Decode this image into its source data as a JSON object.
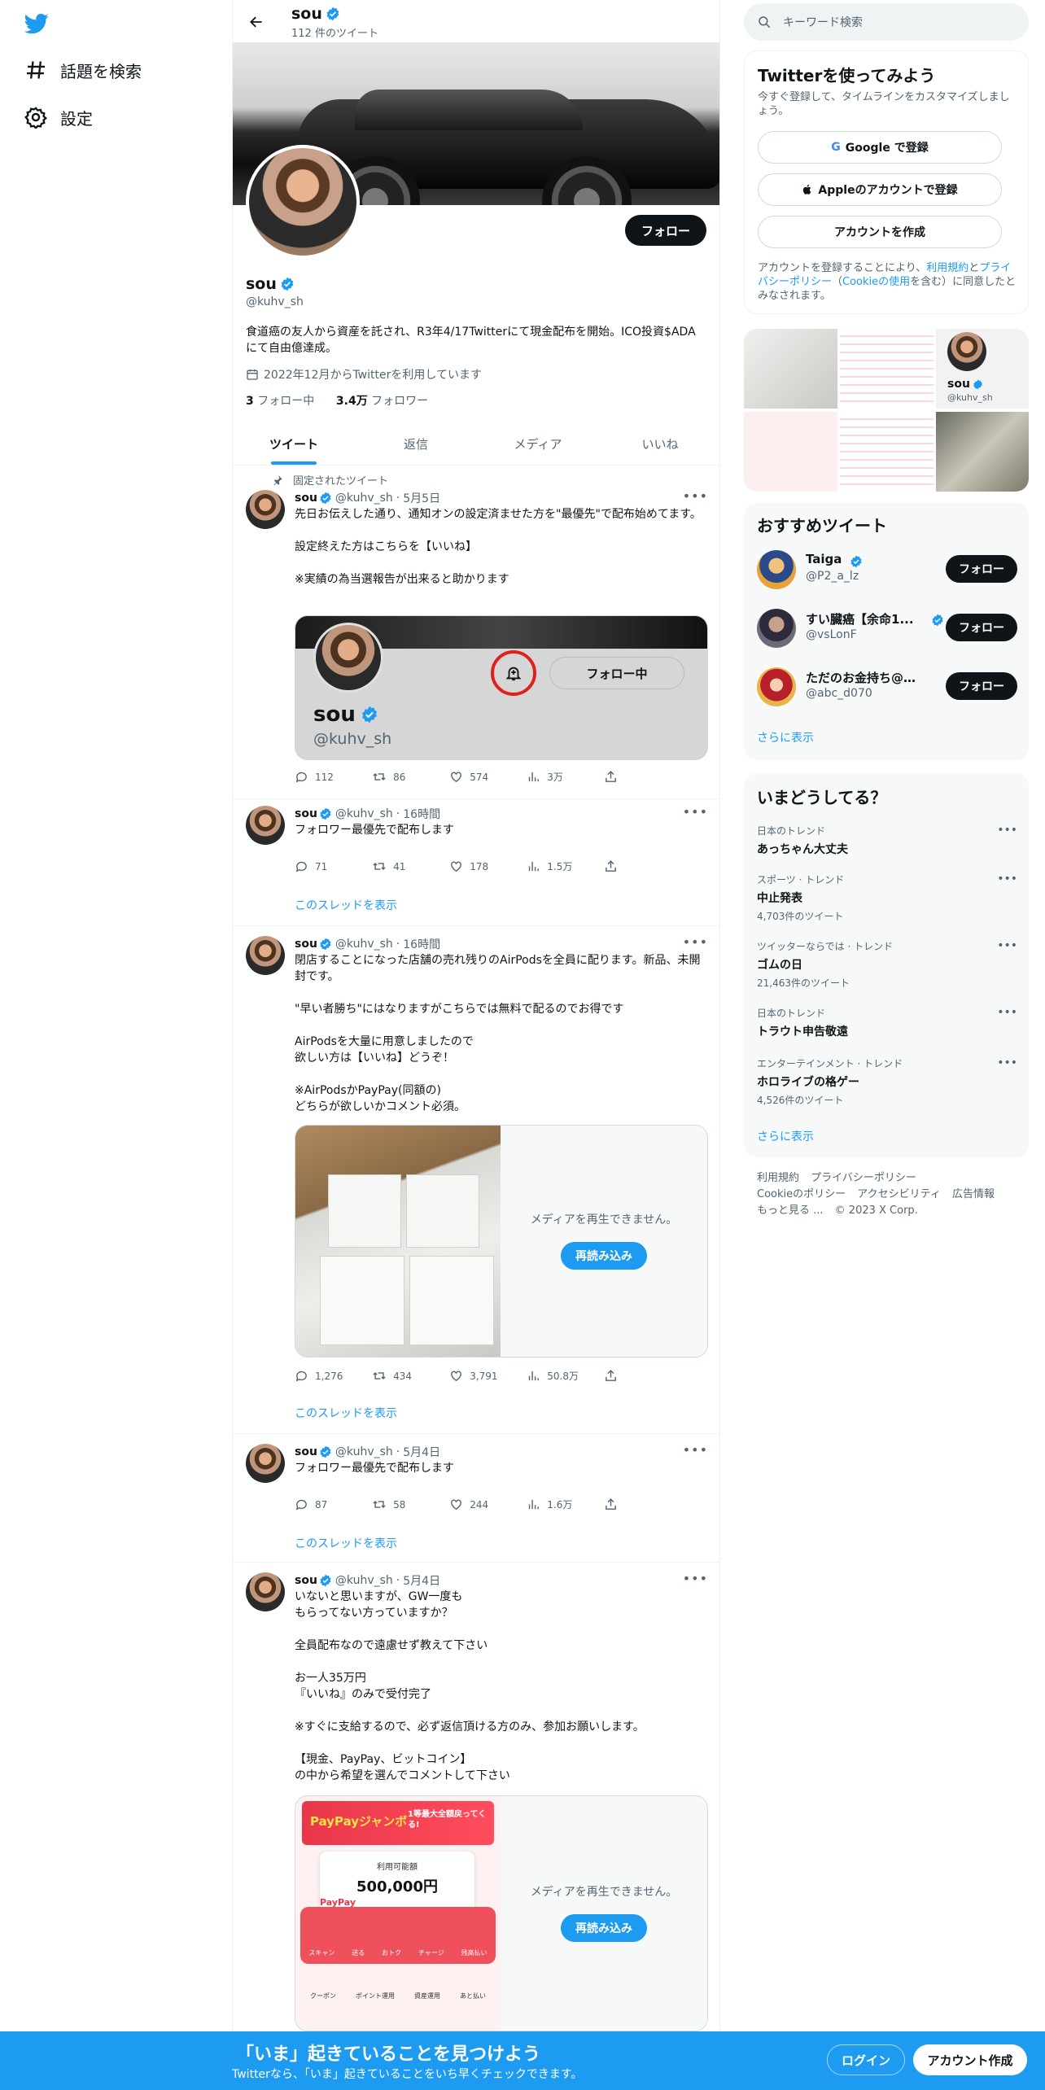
{
  "nav": {
    "explore_label": "話題を検索",
    "settings_label": "設定"
  },
  "header": {
    "name": "sou",
    "tweet_count": "112 件のツイート"
  },
  "profile": {
    "name": "sou",
    "handle": "@kuhv_sh",
    "follow_label": "フォロー",
    "bio": "食道癌の友人から資産を託され、R3年4/17Twitterにて現金配布を開始。ICO投資$ADAにて自由億達成。",
    "joined": "2022年12月からTwitterを利用しています",
    "following_count": "3",
    "following_label": "フォロー中",
    "followers_count": "3.4万",
    "followers_label": "フォロワー"
  },
  "tabs": [
    "ツイート",
    "返信",
    "メディア",
    "いいね"
  ],
  "tweets": [
    {
      "pinned_label": "固定されたツイート",
      "name": "sou",
      "handle": "@kuhv_sh",
      "time": "5月5日",
      "text": "先日お伝えした通り、通知オンの設定済ませた方を\"最優先\"で配布始めてます。\n\n設定終えた方はこちらを【いいね】\n\n※実績の為当選報告が出来ると助かります",
      "card_name": "sou",
      "card_handle": "@kuhv_sh",
      "card_following": "フォロー中",
      "replies": "112",
      "retweets": "86",
      "likes": "574",
      "views": "3万"
    },
    {
      "name": "sou",
      "handle": "@kuhv_sh",
      "time": "16時間",
      "text": "フォロワー最優先で配布します",
      "replies": "71",
      "retweets": "41",
      "likes": "178",
      "views": "1.5万",
      "thread_label": "このスレッドを表示"
    },
    {
      "name": "sou",
      "handle": "@kuhv_sh",
      "time": "16時間",
      "text": "閉店することになった店舗の売れ残りのAirPodsを全員に配ります。新品、未開封です。\n\n\"早い者勝ち\"にはなりますがこちらでは無料で配るのでお得です\n\nAirPodsを大量に用意しましたので\n欲しい方は【いいね】どうぞ！\n\n※AirPodsかPayPay(同額の)\nどちらが欲しいかコメント必須。",
      "media_msg": "メディアを再生できません。",
      "reload_label": "再読み込み",
      "replies": "1,276",
      "retweets": "434",
      "likes": "3,791",
      "views": "50.8万",
      "thread_label": "このスレッドを表示"
    },
    {
      "name": "sou",
      "handle": "@kuhv_sh",
      "time": "5月4日",
      "text": "フォロワー最優先で配布します",
      "replies": "87",
      "retweets": "58",
      "likes": "244",
      "views": "1.6万",
      "thread_label": "このスレッドを表示"
    },
    {
      "name": "sou",
      "handle": "@kuhv_sh",
      "time": "5月4日",
      "text": "いないと思いますが、GW一度も\nもらってない方っていますか？\n\n全員配布なので遠慮せず教えて下さい\n\nお一人35万円\n『いいね』のみで受付完了\n\n※すぐに支給するので、必ず返信頂ける方のみ、参加お願いします。\n\n【現金、PayPay、ビットコイン】\nの中から希望を選んでコメントして下さい",
      "media_msg": "メディアを再生できません。",
      "reload_label": "再読み込み",
      "paypay_title": "利用可能額",
      "paypay_amount": "500,000円",
      "paypay_brand": "PayPay",
      "paypay_banner": "PayPayジャンボ",
      "paypay_banner_sub": "1等最大全額戻ってくる!",
      "paypay_menu": [
        "スキャン",
        "送る",
        "おトク",
        "チャージ",
        "残高払い"
      ],
      "paypay_menu2": [
        "クーポン",
        "ポイント運用",
        "資産運用",
        "あと払い"
      ]
    }
  ],
  "sidebar": {
    "search_placeholder": "キーワード検索",
    "signup": {
      "title": "Twitterを使ってみよう",
      "subtitle": "今すぐ登録して、タイムラインをカスタマイズしましょう。",
      "google_label": "Google で登録",
      "apple_label": "Appleのアカウントで登録",
      "create_label": "アカウントを作成",
      "legal_prefix": "アカウントを登録することにより、",
      "legal_terms": "利用規約",
      "legal_and": "と",
      "legal_privacy": "プライバシーポリシー",
      "legal_cookie_open": "（",
      "legal_cookie": "Cookieの使用",
      "legal_suffix": "を含む）に同意したとみなされます。"
    },
    "photo_grid_card": {
      "name": "sou",
      "handle": "@kuhv_sh"
    },
    "recommended": {
      "title": "おすすめツイート",
      "users": [
        {
          "name": "Taiga",
          "handle": "@P2_a_lz",
          "follow": "フォロー"
        },
        {
          "name": "すい臓癌【余命1...",
          "handle": "@vsLonF",
          "follow": "フォロー"
        },
        {
          "name": "ただのお金持ち@新...",
          "handle": "@abc_d070",
          "follow": "フォロー"
        }
      ],
      "show_more": "さらに表示"
    },
    "trends": {
      "title": "いまどうしてる？",
      "items": [
        {
          "context": "日本のトレンド",
          "title": "あっちゃん大丈夫",
          "count": ""
        },
        {
          "context": "スポーツ · トレンド",
          "title": "中止発表",
          "count": "4,703件のツイート"
        },
        {
          "context": "ツイッターならでは · トレンド",
          "title": "ゴムの日",
          "count": "21,463件のツイート"
        },
        {
          "context": "日本のトレンド",
          "title": "トラウト申告敬遠",
          "count": ""
        },
        {
          "context": "エンターテインメント · トレンド",
          "title": "ホロライブの格ゲー",
          "count": "4,526件のツイート"
        }
      ],
      "show_more": "さらに表示"
    },
    "footer": [
      "利用規約",
      "プライバシーポリシー",
      "Cookieのポリシー",
      "アクセシビリティ",
      "広告情報",
      "もっと見る ...",
      "© 2023 X Corp."
    ]
  },
  "bottom_bar": {
    "title": "「いま」起きていることを見つけよう",
    "subtitle": "Twitterなら、「いま」起きていることをいち早くチェックできます。",
    "login_label": "ログイン",
    "signup_label": "アカウント作成"
  },
  "colors": {
    "accent": "#1d9bf0",
    "text": "#0f1419",
    "muted": "#536471"
  }
}
